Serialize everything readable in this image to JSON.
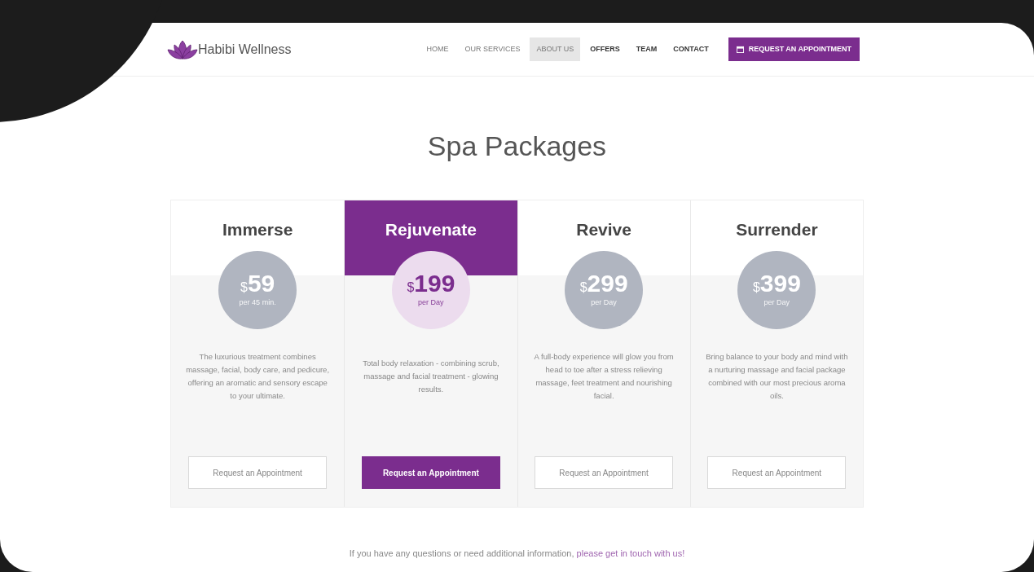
{
  "header": {
    "brand": "Habibi Wellness",
    "nav": [
      {
        "label": "HOME",
        "selected": false,
        "bold": false
      },
      {
        "label": "OUR SERVICES",
        "selected": false,
        "bold": false
      },
      {
        "label": "ABOUT US",
        "selected": true,
        "bold": false
      },
      {
        "label": "OFFERS",
        "selected": false,
        "bold": true
      },
      {
        "label": "TEAM",
        "selected": false,
        "bold": true
      },
      {
        "label": "CONTACT",
        "selected": false,
        "bold": true
      }
    ],
    "cta": "REQUEST AN APPOINTMENT"
  },
  "title": "Spa Packages",
  "packages": [
    {
      "name": "Immerse",
      "currency": "$",
      "price": "59",
      "period": "per 45 min.",
      "description": "The luxurious treatment combines massage, facial, body care, and pedicure, offering an aromatic and sensory escape to your ultimate.",
      "button": "Request an Appointment",
      "featured": false
    },
    {
      "name": "Rejuvenate",
      "currency": "$",
      "price": "199",
      "period": "per Day",
      "description": "Total body relaxation - combining scrub, massage and facial treatment - glowing results.",
      "button": "Request an Appointment",
      "featured": true
    },
    {
      "name": "Revive",
      "currency": "$",
      "price": "299",
      "period": "per Day",
      "description": "A full-body experience will glow you from head to toe after a stress relieving massage, feet treatment and nourishing facial.",
      "button": "Request an Appointment",
      "featured": false
    },
    {
      "name": "Surrender",
      "currency": "$",
      "price": "399",
      "period": "per Day",
      "description": "Bring balance to your body and mind with a nurturing massage and facial package combined with our most precious aroma oils.",
      "button": "Request an Appointment",
      "featured": false
    }
  ],
  "footer": {
    "text": "If you have any questions or need additional information,",
    "link": "please get in touch with us!"
  }
}
